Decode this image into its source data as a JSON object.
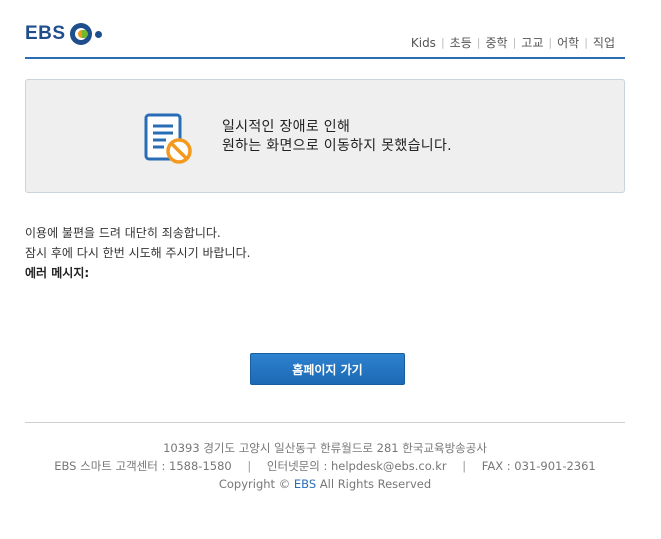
{
  "header": {
    "logo_text": "EBS",
    "nav": [
      "Kids",
      "초등",
      "중학",
      "고교",
      "어학",
      "직업"
    ],
    "accent": "#2a6db7"
  },
  "alert": {
    "icon": "document-blocked-icon",
    "line1": "일시적인 장애로 인해",
    "line2": "원하는 화면으로 이동하지 못했습니다."
  },
  "description": {
    "line1": "이용에 불편을 드려 대단히 죄송합니다.",
    "line2": "잠시 후에 다시 한번 시도해 주시기 바랍니다.",
    "error_label": "에러 메시지:"
  },
  "button": {
    "home_label": "홈페이지 가기"
  },
  "footer": {
    "address": "10393 경기도 고양시 일산동구 한류월드로 281 한국교육방송공사",
    "customer_center": "EBS 스마트 고객센터 : 1588-1580",
    "inquiry": "인터넷문의 : helpdesk@ebs.co.kr",
    "fax": "FAX : 031-901-2361",
    "copyright_prefix": "Copyright ©",
    "copyright_brand": "EBS",
    "copyright_suffix": "All Rights Reserved"
  }
}
